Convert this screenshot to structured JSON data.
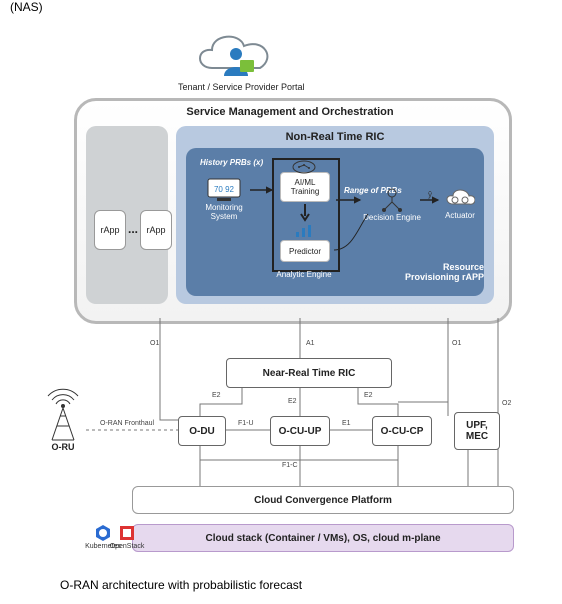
{
  "fragment_top": "(NAS)",
  "tenant_label": "Tenant / Service Provider Portal",
  "smo": {
    "title": "Service Management and Orchestration",
    "nrt_title": "Non-Real Time RIC",
    "rapp_left": "rApp",
    "rapp_right": "rApp",
    "dots": "...",
    "history_label": "History PRBs (x)",
    "aiml_box": "AI/ML\nTraining",
    "predictor_box": "Predictor",
    "analytic_engine": "Analytic\nEngine",
    "monitoring_box": "Monitoring\nSystem",
    "monitor_value": "70  92",
    "range_label": "Range of PRBs",
    "decision_engine": "Decision Engine",
    "actuator": "Actuator",
    "y_hat": "ŷ",
    "resource_rapp": "Resource\nProvisioning rAPP"
  },
  "interfaces": {
    "o1_left": "O1",
    "a1": "A1",
    "o1_right": "O1",
    "e2_a": "E2",
    "e2_b": "E2",
    "e2_c": "E2",
    "f1u": "F1-U",
    "f1c": "F1-C",
    "e1": "E1",
    "o2": "O2",
    "fronthaul": "O-RAN Fronthaul"
  },
  "blocks": {
    "near_rt": "Near-Real Time RIC",
    "odu": "O-DU",
    "ocuup": "O-CU-UP",
    "ocucp": "O-CU-CP",
    "upf": "UPF,\nMEC",
    "oru": "O-RU",
    "ccp": "Cloud Convergence Platform",
    "stack": "Cloud stack (Container / VMs), OS, cloud m-plane",
    "k8s": "Kubernetes",
    "openstack": "OpenStack"
  },
  "caption": "O-RAN architecture with probabilistic forecast",
  "colors": {
    "nrt_dark": "#5b7ea8",
    "cloud_stroke": "#7e8a93"
  }
}
